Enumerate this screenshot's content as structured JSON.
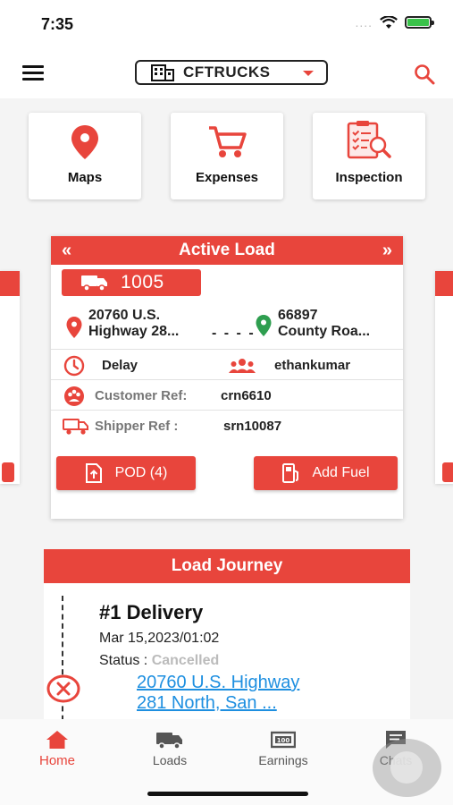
{
  "status_bar": {
    "time": "7:35",
    "dots": "...."
  },
  "header": {
    "company": "CFTRUCKS"
  },
  "quick_actions": [
    {
      "label": "Maps",
      "icon": "location-pin-icon"
    },
    {
      "label": "Expenses",
      "icon": "cart-icon"
    },
    {
      "label": "Inspection",
      "icon": "inspection-clipboard-icon"
    }
  ],
  "active_load": {
    "title": "Active Load",
    "prev": "«",
    "next": "»",
    "load_number": "1005",
    "from_address": "20760 U.S.\nHighway 28...",
    "to_address": "66897\nCounty Roa...",
    "route_dashes": "- - - -",
    "status": "Delay",
    "driver": "ethankumar",
    "customer_ref_label": "Customer Ref:",
    "customer_ref": "crn6610",
    "shipper_ref_label": "Shipper Ref :",
    "shipper_ref": "srn10087",
    "pod_label": "POD (4)",
    "add_fuel_label": "Add Fuel"
  },
  "load_journey": {
    "title": "Load Journey",
    "stop_title": "#1  Delivery",
    "stop_date": "Mar 15,2023/01:02",
    "status_label": "Status : ",
    "status_value": "Cancelled",
    "stop_address": "20760 U.S. Highway\n281 North, San ..."
  },
  "bottom_nav": [
    {
      "label": "Home",
      "icon": "home-icon",
      "active": true
    },
    {
      "label": "Loads",
      "icon": "truck-icon",
      "active": false
    },
    {
      "label": "Earnings",
      "icon": "cash-icon",
      "active": false
    },
    {
      "label": "Chats",
      "icon": "chat-icon",
      "active": false
    }
  ],
  "colors": {
    "accent": "#e8453c",
    "link": "#1e8fe0",
    "location_green": "#2e9e4f"
  }
}
